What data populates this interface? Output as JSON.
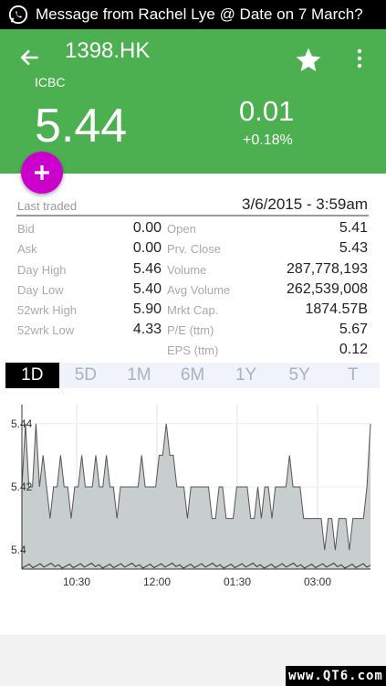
{
  "notification": {
    "icon": "whatsapp-icon",
    "text": "Message from Rachel Lye @ Date on 7 March?"
  },
  "header": {
    "symbol": "1398.HK",
    "company": "ICBC",
    "price": "5.44",
    "change": "0.01",
    "change_pct": "+0.18%",
    "bg_color": "#4caf50"
  },
  "stats": {
    "last_traded_label": "Last traded",
    "last_traded_value": "3/6/2015 - 3:59am",
    "left": [
      {
        "label": "Bid",
        "value": "0.00"
      },
      {
        "label": "Ask",
        "value": "0.00"
      },
      {
        "label": "Day High",
        "value": "5.46"
      },
      {
        "label": "Day Low",
        "value": "5.40"
      },
      {
        "label": "52wrk High",
        "value": "5.90"
      },
      {
        "label": "52wrk Low",
        "value": "4.33"
      }
    ],
    "right": [
      {
        "label": "Open",
        "value": "5.41"
      },
      {
        "label": "Prv. Close",
        "value": "5.43"
      },
      {
        "label": "Volume",
        "value": "287,778,193"
      },
      {
        "label": "Avg Volume",
        "value": "262,539,008"
      },
      {
        "label": "Mrkt Cap.",
        "value": "1874.57B"
      },
      {
        "label": "P/E (ttm)",
        "value": "5.67"
      },
      {
        "label": "EPS (ttm)",
        "value": "0.12"
      }
    ]
  },
  "tabs": [
    "1D",
    "5D",
    "1M",
    "6M",
    "1Y",
    "5Y",
    "T"
  ],
  "active_tab": "1D",
  "watermark": "www.QT6.com",
  "chart_data": {
    "type": "area",
    "y_ticks": [
      "5.44",
      "5.42",
      "5.4"
    ],
    "x_ticks": [
      "10:30",
      "12:00",
      "01:30",
      "03:00"
    ],
    "ylim": [
      5.394,
      5.446
    ],
    "fill_color": "#c8cece",
    "line_color": "#555555",
    "values": [
      5.42,
      5.44,
      5.42,
      5.42,
      5.44,
      5.42,
      5.43,
      5.42,
      5.41,
      5.42,
      5.42,
      5.43,
      5.42,
      5.42,
      5.41,
      5.42,
      5.42,
      5.43,
      5.42,
      5.42,
      5.42,
      5.43,
      5.42,
      5.42,
      5.43,
      5.42,
      5.42,
      5.41,
      5.42,
      5.42,
      5.42,
      5.42,
      5.42,
      5.42,
      5.43,
      5.42,
      5.42,
      5.42,
      5.42,
      5.43,
      5.43,
      5.44,
      5.43,
      5.43,
      5.42,
      5.42,
      5.42,
      5.41,
      5.42,
      5.42,
      5.42,
      5.42,
      5.42,
      5.42,
      5.41,
      5.41,
      5.42,
      5.42,
      5.41,
      5.41,
      5.41,
      5.42,
      5.42,
      5.42,
      5.42,
      5.41,
      5.41,
      5.42,
      5.41,
      5.42,
      5.42,
      5.41,
      5.42,
      5.42,
      5.42,
      5.42,
      5.43,
      5.42,
      5.42,
      5.42,
      5.41,
      5.41,
      5.41,
      5.41,
      5.41,
      5.41,
      5.4,
      5.41,
      5.41,
      5.4,
      5.41,
      5.41,
      5.41,
      5.4,
      5.41,
      5.41,
      5.41,
      5.41,
      5.42,
      5.44
    ]
  }
}
